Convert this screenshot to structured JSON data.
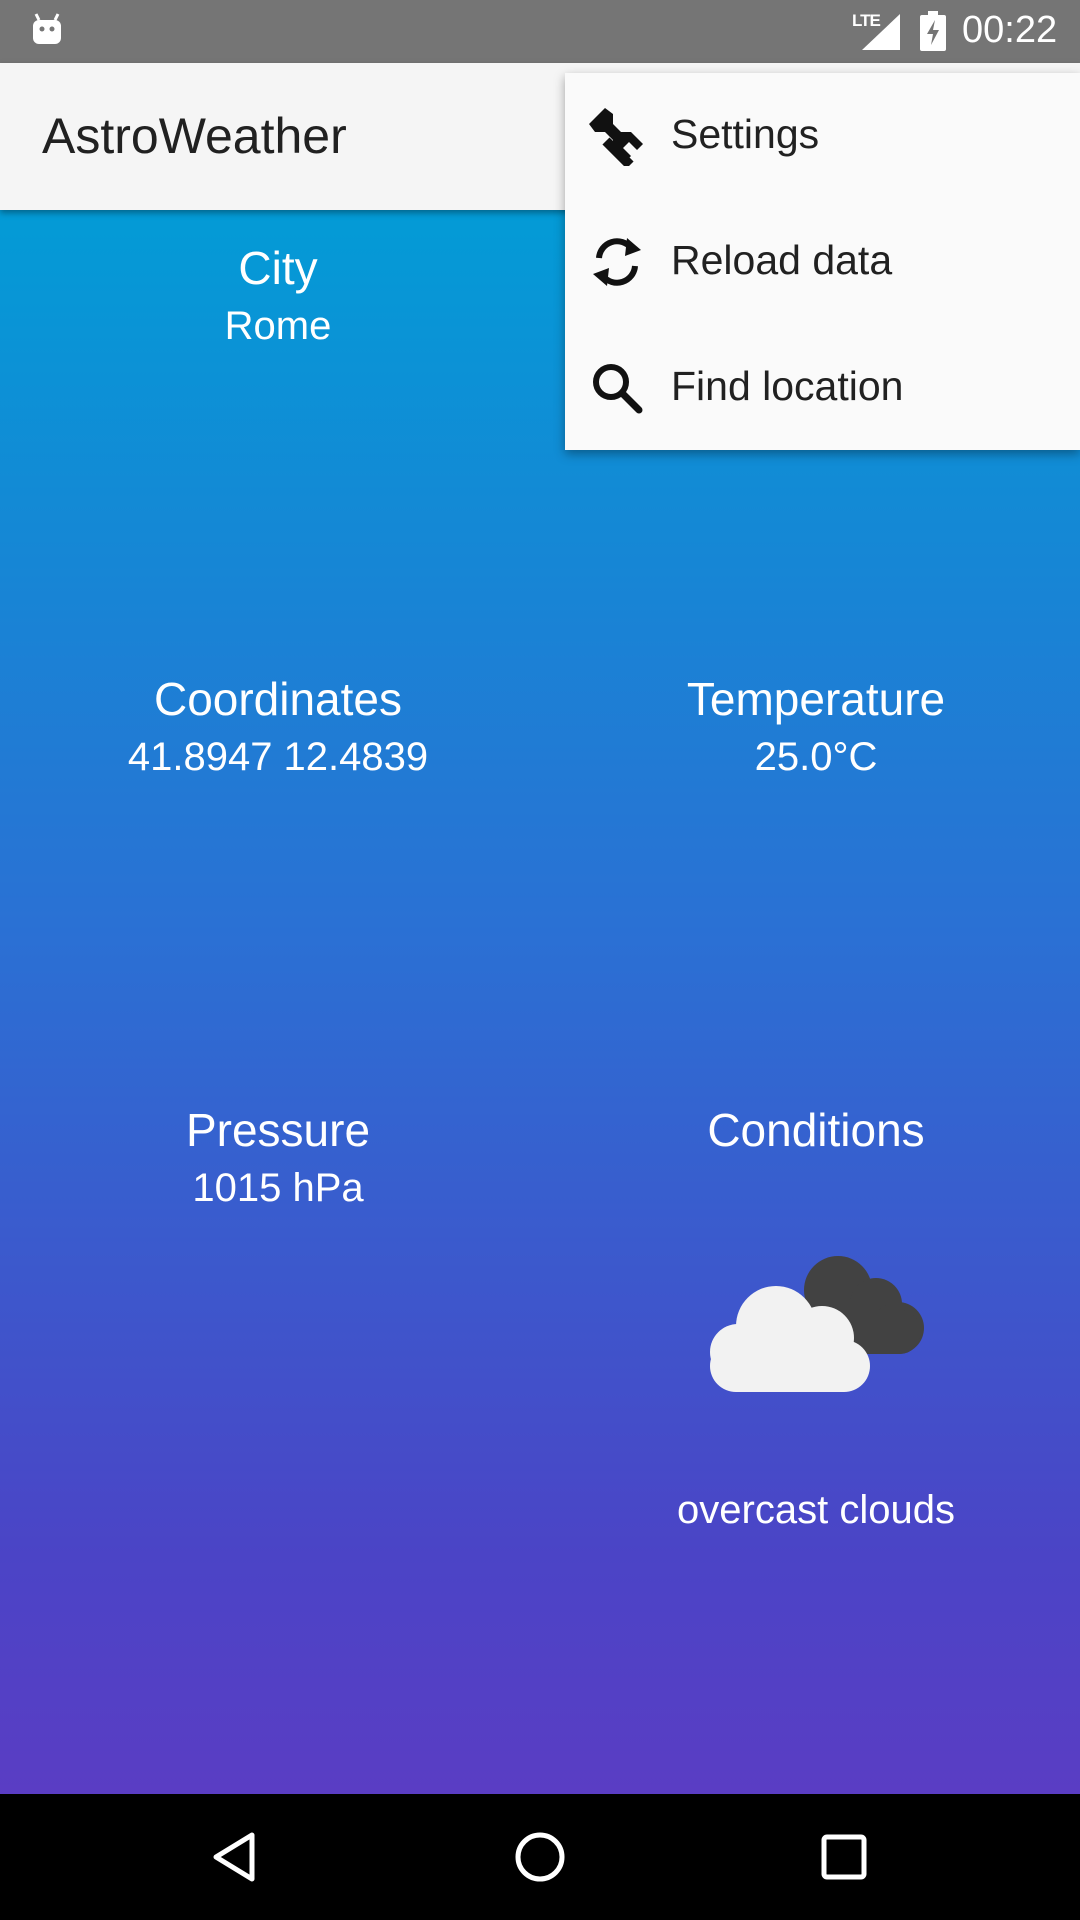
{
  "status_bar": {
    "network": "LTE",
    "time": "00:22",
    "icons": [
      "android-debug-icon",
      "signal-icon",
      "battery-charging-icon"
    ]
  },
  "app_bar": {
    "title": "AstroWeather"
  },
  "overflow_menu": {
    "items": [
      {
        "label": "Settings",
        "icon": "wrench-icon"
      },
      {
        "label": "Reload data",
        "icon": "refresh-icon"
      },
      {
        "label": "Find location",
        "icon": "search-icon"
      }
    ]
  },
  "weather": {
    "city": {
      "label": "City",
      "value": "Rome"
    },
    "coordinates": {
      "label": "Coordinates",
      "value": "41.8947 12.4839"
    },
    "temperature": {
      "label": "Temperature",
      "value": "25.0°C"
    },
    "pressure": {
      "label": "Pressure",
      "value": "1015 hPa"
    },
    "conditions": {
      "label": "Conditions",
      "value": "overcast clouds",
      "icon": "overcast-clouds-icon"
    }
  },
  "colors": {
    "gradient_top": "#039bd6",
    "gradient_bottom": "#5a3dc4",
    "app_bar": "#f5f5f5",
    "status_bar": "#757575"
  },
  "nav_bar": {
    "buttons": [
      "back-icon",
      "home-icon",
      "recents-icon"
    ]
  }
}
